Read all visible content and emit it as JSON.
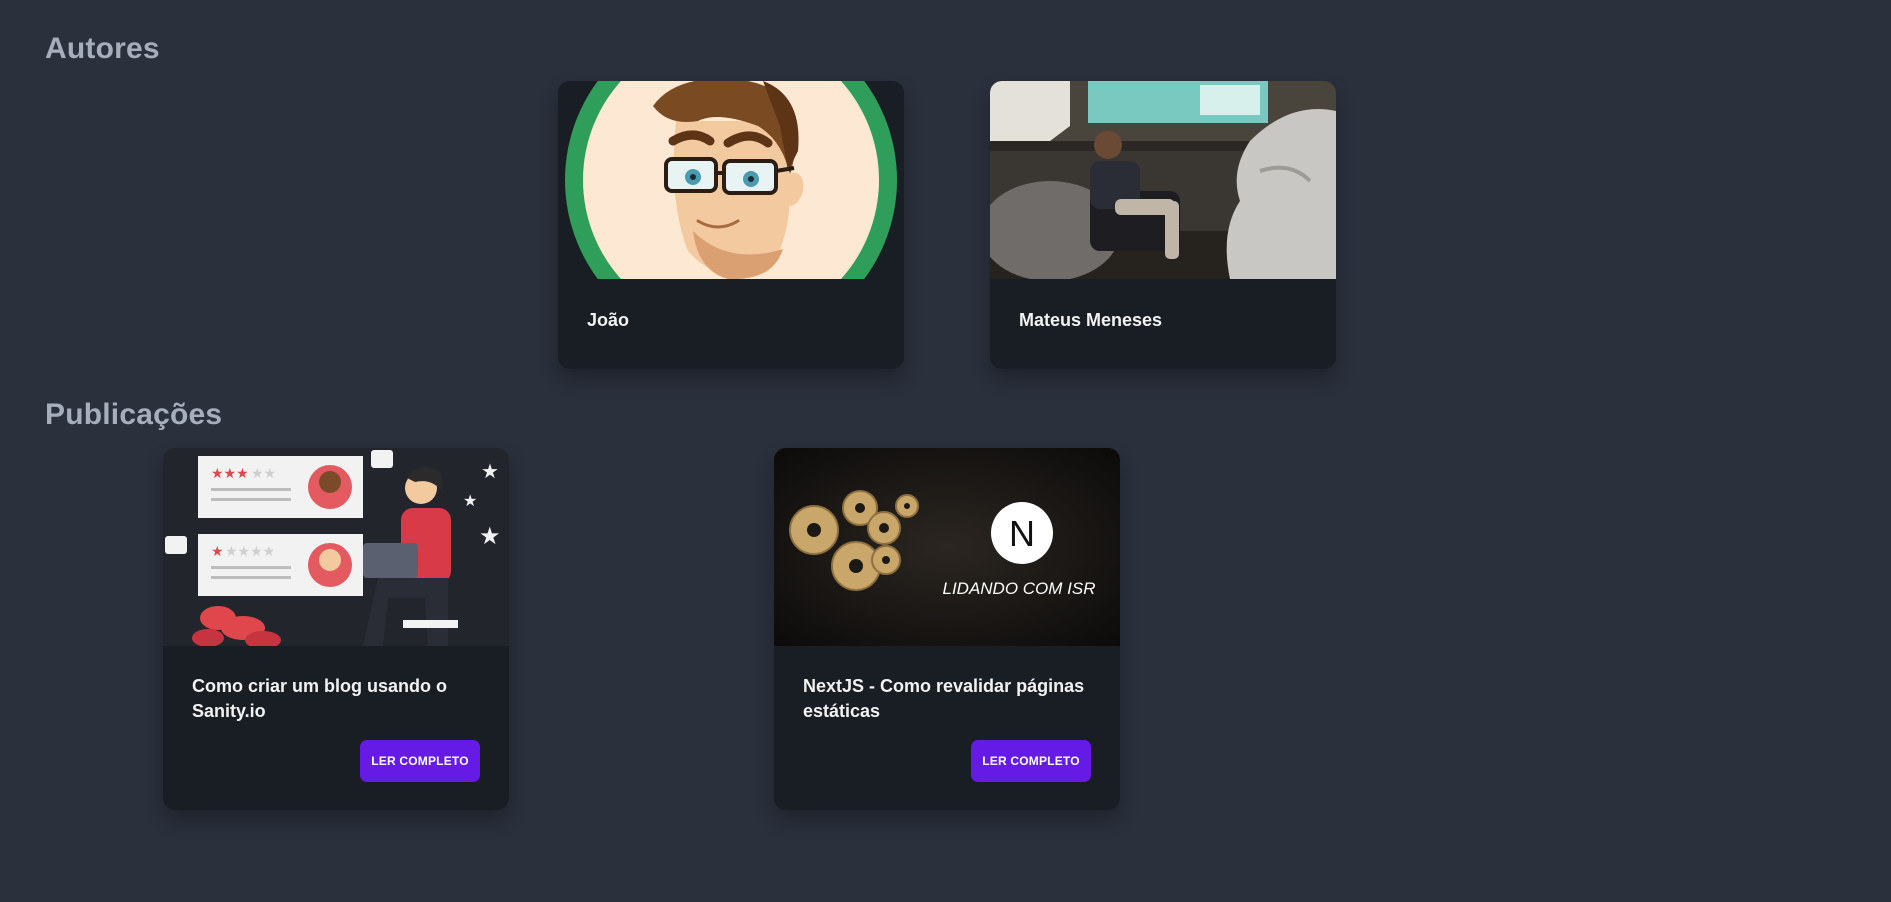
{
  "sections": {
    "authors_title": "Autores",
    "posts_title": "Publicações"
  },
  "authors": [
    {
      "name": "João",
      "image": "cartoon-avatar-illustration"
    },
    {
      "name": "Mateus Meneses",
      "image": "speaker-photo"
    }
  ],
  "posts": [
    {
      "title": "Como criar um blog usando o Sanity.io",
      "button_label": "LER COMPLETO",
      "image": "reviews-illustration"
    },
    {
      "title": "NextJS - Como revalidar páginas estáticas",
      "button_label": "LER COMPLETO",
      "image": "gears-nextjs-banner",
      "image_text": "LIDANDO COM ISR",
      "image_logo": "N"
    }
  ],
  "colors": {
    "background": "#2a303c",
    "card": "#191d24",
    "heading": "#a6adbb",
    "button": "#661ae6"
  }
}
